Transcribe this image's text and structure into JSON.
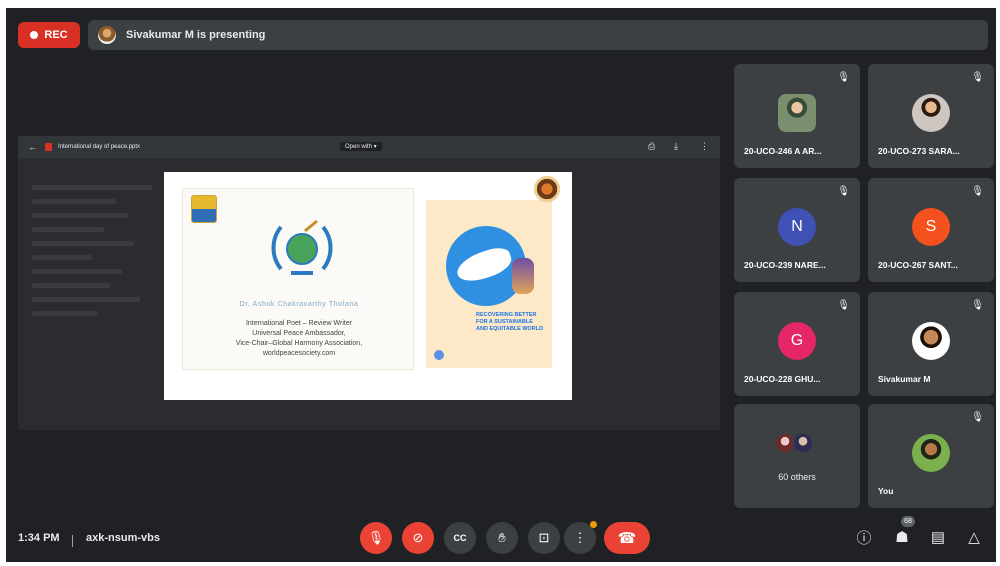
{
  "rec_label": "REC",
  "presenting_text": "Sivakumar M is presenting",
  "presentation": {
    "doc_name": "International day of peace.pptx",
    "open_with": "Open with ▾",
    "slide": {
      "name_line": "Dr. Ashok Chakravarthy Tholana",
      "lines": [
        "International Poet – Review Writer",
        "Universal Peace Ambassador,",
        "Vice-Chair–Global Harmony Association,",
        "worldpeacesociety.com"
      ],
      "campaign_text": "RECOVERING BETTER FOR A SUSTAINABLE AND EQUITABLE WORLD"
    }
  },
  "tiles": [
    {
      "name": "20-UCO-246 A AR...",
      "avatar_letter": "",
      "avatar_color": ""
    },
    {
      "name": "20-UCO-273 SARA...",
      "avatar_letter": "",
      "avatar_color": ""
    },
    {
      "name": "20-UCO-239 NARE...",
      "avatar_letter": "N",
      "avatar_color": "#3f51b5"
    },
    {
      "name": "20-UCO-267 SANT...",
      "avatar_letter": "S",
      "avatar_color": "#f4511e"
    },
    {
      "name": "20-UCO-228 GHU...",
      "avatar_letter": "G",
      "avatar_color": "#e52667"
    },
    {
      "name": "Sivakumar M",
      "avatar_letter": "",
      "avatar_color": ""
    },
    {
      "name": "You",
      "avatar_letter": "",
      "avatar_color": ""
    }
  ],
  "others_label": "60 others",
  "bottom": {
    "time": "1:34 PM",
    "meeting_code": "axk-nsum-vbs",
    "participants_count": "68"
  },
  "icons": {
    "mic_muted": "🎙",
    "cam_off": "⊘",
    "captions": "CC",
    "raise_hand": "✋",
    "present": "⊡",
    "more": "⋮",
    "end_call": "☎",
    "info": "ⓘ",
    "people": "👥",
    "chat": "💬",
    "activities": "△"
  },
  "colors": {
    "background": "#202124",
    "tile": "#3c4043",
    "rec": "#d93025",
    "red_button": "#ea4335"
  }
}
